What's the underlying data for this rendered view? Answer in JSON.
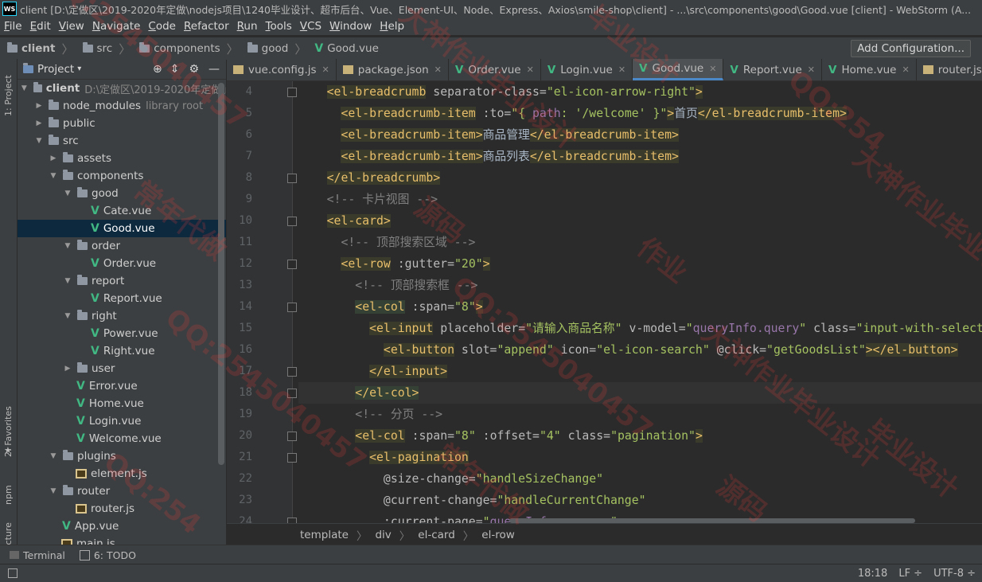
{
  "title_bar": {
    "text": "client [D:\\定做区\\2019-2020年定做\\nodejs项目\\1240毕业设计、超市后台、Vue、Element-UI、Node、Express、Axios\\smile-shop\\client] - ...\\src\\components\\good\\Good.vue [client] - WebStorm (A...",
    "logo": "WS"
  },
  "menu": [
    "File",
    "Edit",
    "View",
    "Navigate",
    "Code",
    "Refactor",
    "Run",
    "Tools",
    "VCS",
    "Window",
    "Help"
  ],
  "breadcrumb": [
    "client",
    "src",
    "components",
    "good",
    "Good.vue"
  ],
  "add_config_label": "Add Configuration...",
  "left_tabs": {
    "project": "1: Project",
    "favorites": "2: Favorites",
    "npm": "npm",
    "structure": "Z: Structure"
  },
  "project_panel": {
    "title": "Project"
  },
  "tree": [
    {
      "label": "client",
      "sub": "D:\\定做区\\2019-2020年定做\\r",
      "type": "folder",
      "depth": 0,
      "open": true,
      "bold": true
    },
    {
      "label": "node_modules",
      "sub": "library root",
      "type": "folder",
      "depth": 1,
      "open": false
    },
    {
      "label": "public",
      "type": "folder",
      "depth": 1,
      "open": false
    },
    {
      "label": "src",
      "type": "folder",
      "depth": 1,
      "open": true
    },
    {
      "label": "assets",
      "type": "folder",
      "depth": 2,
      "open": false
    },
    {
      "label": "components",
      "type": "folder",
      "depth": 2,
      "open": true
    },
    {
      "label": "good",
      "type": "folder",
      "depth": 3,
      "open": true
    },
    {
      "label": "Cate.vue",
      "type": "vue",
      "depth": 4
    },
    {
      "label": "Good.vue",
      "type": "vue",
      "depth": 4,
      "selected": true
    },
    {
      "label": "order",
      "type": "folder",
      "depth": 3,
      "open": true
    },
    {
      "label": "Order.vue",
      "type": "vue",
      "depth": 4
    },
    {
      "label": "report",
      "type": "folder",
      "depth": 3,
      "open": true
    },
    {
      "label": "Report.vue",
      "type": "vue",
      "depth": 4
    },
    {
      "label": "right",
      "type": "folder",
      "depth": 3,
      "open": true
    },
    {
      "label": "Power.vue",
      "type": "vue",
      "depth": 4
    },
    {
      "label": "Right.vue",
      "type": "vue",
      "depth": 4
    },
    {
      "label": "user",
      "type": "folder",
      "depth": 3,
      "open": false
    },
    {
      "label": "Error.vue",
      "type": "vue",
      "depth": 3
    },
    {
      "label": "Home.vue",
      "type": "vue",
      "depth": 3
    },
    {
      "label": "Login.vue",
      "type": "vue",
      "depth": 3
    },
    {
      "label": "Welcome.vue",
      "type": "vue",
      "depth": 3
    },
    {
      "label": "plugins",
      "type": "folder",
      "depth": 2,
      "open": true
    },
    {
      "label": "element.js",
      "type": "js",
      "depth": 3
    },
    {
      "label": "router",
      "type": "folder",
      "depth": 2,
      "open": true
    },
    {
      "label": "router.js",
      "type": "js",
      "depth": 3
    },
    {
      "label": "App.vue",
      "type": "vue",
      "depth": 2
    },
    {
      "label": "main.js",
      "type": "js",
      "depth": 2
    }
  ],
  "tabs": [
    {
      "label": "vue.config.js",
      "type": "js"
    },
    {
      "label": "package.json",
      "type": "json"
    },
    {
      "label": "Order.vue",
      "type": "vue"
    },
    {
      "label": "Login.vue",
      "type": "vue"
    },
    {
      "label": "Good.vue",
      "type": "vue",
      "active": true
    },
    {
      "label": "Report.vue",
      "type": "vue"
    },
    {
      "label": "Home.vue",
      "type": "vue"
    },
    {
      "label": "router.js",
      "type": "js"
    }
  ],
  "code": [
    {
      "n": "4",
      "html": "    <span class='t'>&lt;el-breadcrumb</span> <span class='a'>separator-class=</span><span class='s'>\"el-icon-arrow-right\"</span><span class='t'>&gt;</span>"
    },
    {
      "n": "5",
      "html": "      <span class='t'>&lt;el-breadcrumb-item</span> <span class='a'>:to=</span><span class='s'>\"{ </span><span class='bind'>path</span><span class='s'>: '/welcome' }\"</span><span class='t'>&gt;</span>首页<span class='t'>&lt;/el-breadcrumb-item&gt;</span>"
    },
    {
      "n": "6",
      "html": "      <span class='t'>&lt;el-breadcrumb-item&gt;</span>商品管理<span class='t'>&lt;/el-breadcrumb-item&gt;</span>"
    },
    {
      "n": "7",
      "html": "      <span class='t'>&lt;el-breadcrumb-item&gt;</span>商品列表<span class='t'>&lt;/el-breadcrumb-item&gt;</span>"
    },
    {
      "n": "8",
      "html": "    <span class='t'>&lt;/el-breadcrumb&gt;</span>"
    },
    {
      "n": "9",
      "html": "    <span class='c'>&lt;!-- 卡片视图 --&gt;</span>"
    },
    {
      "n": "10",
      "html": "    <span class='t'>&lt;el-card&gt;</span>"
    },
    {
      "n": "11",
      "html": "      <span class='c'>&lt;!-- 顶部搜索区域 --&gt;</span>"
    },
    {
      "n": "12",
      "html": "      <span class='t'>&lt;el-row</span> <span class='a'>:gutter=</span><span class='s'>\"20\"</span><span class='t'>&gt;</span>"
    },
    {
      "n": "13",
      "html": "        <span class='c'>&lt;!-- 顶部搜索框 --&gt;</span>"
    },
    {
      "n": "14",
      "html": "        <span class='t hl'>&lt;el-col</span> <span class='a'>:span=</span><span class='s'>\"8\"</span><span class='t'>&gt;</span>"
    },
    {
      "n": "15",
      "html": "          <span class='t'>&lt;el-input</span> <span class='a'>placeholder=</span><span class='s'>\"请输入商品名称\"</span> <span class='a'>v-model=</span><span class='s'>\"</span><span class='bind'>queryInfo.query</span><span class='s'>\"</span> <span class='a'>class=</span><span class='s'>\"input-with-select\"</span><span class='t'>&gt;</span>"
    },
    {
      "n": "16",
      "html": "            <span class='t'>&lt;el-button</span> <span class='a'>slot=</span><span class='s'>\"append\"</span> <span class='a'>icon=</span><span class='s'>\"el-icon-search\"</span> <span class='a'>@click=</span><span class='s'>\"getGoodsList\"</span><span class='t'>&gt;&lt;/el-button&gt;</span>"
    },
    {
      "n": "17",
      "html": "          <span class='t'>&lt;/el-input&gt;</span>"
    },
    {
      "n": "18",
      "html": "        <span class='t hl'>&lt;/el-col&gt;</span>",
      "current": true
    },
    {
      "n": "19",
      "html": "        <span class='c'>&lt;!-- 分页 --&gt;</span>"
    },
    {
      "n": "20",
      "html": "        <span class='t'>&lt;el-col</span> <span class='a'>:span=</span><span class='s'>\"8\"</span> <span class='a'>:offset=</span><span class='s'>\"4\"</span> <span class='a'>class=</span><span class='s'>\"pagination\"</span><span class='t'>&gt;</span>"
    },
    {
      "n": "21",
      "html": "          <span class='t'>&lt;el-pagination</span>"
    },
    {
      "n": "22",
      "html": "            <span class='a'>@size-change=</span><span class='s'>\"handleSizeChange\"</span>"
    },
    {
      "n": "23",
      "html": "            <span class='a'>@current-change=</span><span class='s'>\"handleCurrentChange\"</span>"
    },
    {
      "n": "24",
      "html": "            <span class='a'>:current-page=</span><span class='s'>\"</span><span class='bind'>queryInfo.pagenum</span><span class='s'>\"</span>"
    }
  ],
  "editor_breadcrumb": [
    "template",
    "div",
    "el-card",
    "el-row"
  ],
  "tool_tabs": [
    {
      "label": "Terminal",
      "icon": "terminal-icon"
    },
    {
      "label": "6: TODO",
      "icon": "todo-icon"
    }
  ],
  "status": {
    "position": "18:18",
    "line_sep": "LF ÷",
    "encoding": "UTF-8 ÷"
  },
  "watermarks": [
    "QQ:2545040457",
    "大神作业毕业设计",
    "毕业设计",
    "QQ:254",
    "常年代做",
    "源码",
    "作业",
    "大神作业毕业设计",
    "QQ:2545040457"
  ]
}
